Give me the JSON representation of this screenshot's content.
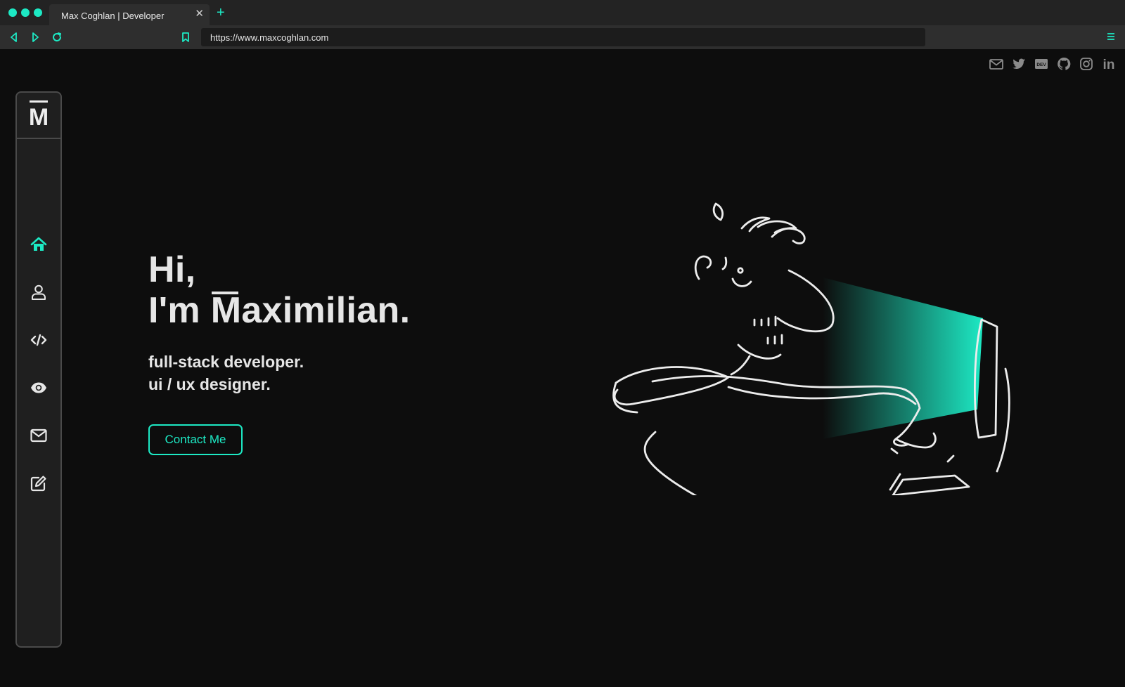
{
  "browser": {
    "tab_title": "Max Coghlan | Developer",
    "tab_close": "✕",
    "new_tab": "+",
    "url": "https://www.maxcoghlan.com",
    "accent": "#1de9c4",
    "icons": [
      "back-icon",
      "forward-icon",
      "reload-icon",
      "bookmark-icon",
      "menu-icon"
    ]
  },
  "social": {
    "icons": [
      "mail-icon",
      "twitter-icon",
      "dev-icon",
      "github-icon",
      "instagram-icon",
      "linkedin-icon"
    ],
    "dev_label": "DEV",
    "linkedin_label": "in"
  },
  "sidebar": {
    "logo": "M",
    "items": [
      {
        "name": "home",
        "icon": "home-icon",
        "active": true
      },
      {
        "name": "about",
        "icon": "user-icon",
        "active": false
      },
      {
        "name": "skills",
        "icon": "code-icon",
        "active": false
      },
      {
        "name": "work",
        "icon": "eye-icon",
        "active": false
      },
      {
        "name": "contact",
        "icon": "mail-icon",
        "active": false
      },
      {
        "name": "blog",
        "icon": "edit-icon",
        "active": false
      }
    ]
  },
  "hero": {
    "line1": "Hi,",
    "line2_prefix": "I'm ",
    "name_initial": "M",
    "name_rest": "aximilian.",
    "role1": "full-stack developer.",
    "role2": "ui / ux designer.",
    "contact_button": "Contact Me"
  },
  "colors": {
    "background": "#0d0d0d",
    "sidebar_bg": "#1f1f1f",
    "text": "#e6e6e6",
    "accent": "#1de9c4"
  }
}
